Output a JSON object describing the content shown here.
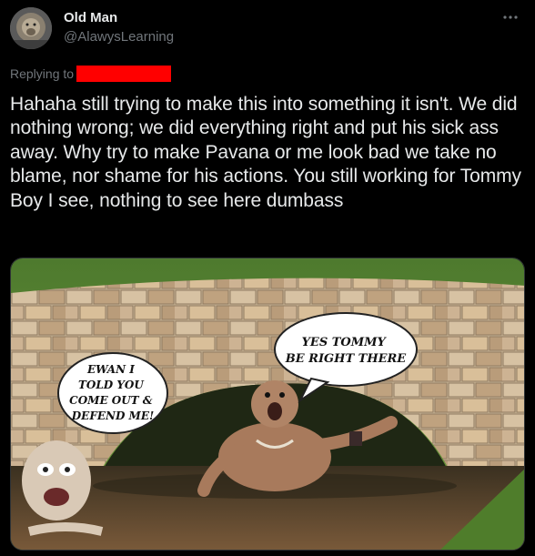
{
  "author": {
    "display_name": "Old Man",
    "handle": "@AlawysLearning",
    "avatar_icon": "lion-avatar-icon"
  },
  "more_icon": "more-horizontal-icon",
  "reply": {
    "label": "Replying to",
    "redaction_color": "#ff0000"
  },
  "tweet": {
    "text": "Hahaha still trying to make this into something it isn't. We did nothing wrong; we did everything right and put his sick ass away. Why try to make Pavana or me look bad we take no blame, nor shame for his actions. You still working for Tommy Boy I see, nothing to see here dumbass"
  },
  "media": {
    "bubble_left": [
      "EWAN I",
      "TOLD YOU",
      "COME OUT &",
      "DEFEND ME!"
    ],
    "bubble_right": [
      "YES TOMMY",
      "BE RIGHT THERE"
    ]
  },
  "colors": {
    "background": "#000000",
    "text_primary": "#e7e9ea",
    "text_secondary": "#71767b"
  }
}
